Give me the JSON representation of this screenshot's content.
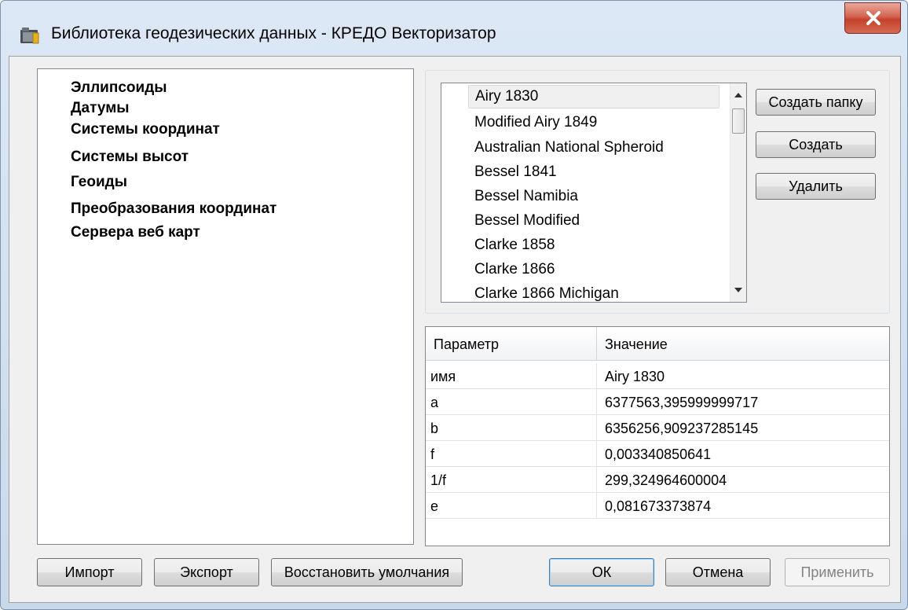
{
  "window": {
    "title": "Библиотека геодезических данных - КРЕДО Векторизатор",
    "close_symbol": "x"
  },
  "tree": {
    "items": [
      {
        "label": "Эллипсоиды"
      },
      {
        "label": "Датумы"
      },
      {
        "label": "Системы координат"
      },
      {
        "label": "Системы высот"
      },
      {
        "label": "Геоиды"
      },
      {
        "label": "Преобразования координат"
      },
      {
        "label": "Сервера веб карт"
      }
    ]
  },
  "list": {
    "selected": "Airy 1830",
    "items": [
      {
        "label": "Airy 1830"
      },
      {
        "label": "Modified Airy 1849"
      },
      {
        "label": "Australian National Spheroid"
      },
      {
        "label": "Bessel 1841"
      },
      {
        "label": "Bessel Namibia"
      },
      {
        "label": "Bessel Modified"
      },
      {
        "label": "Clarke 1858"
      },
      {
        "label": "Clarke 1866"
      },
      {
        "label": "Clarke 1866 Michigan"
      }
    ]
  },
  "side_buttons": {
    "create_folder": "Создать папку",
    "create": "Создать",
    "delete": "Удалить"
  },
  "properties": {
    "columns": {
      "param": "Параметр",
      "value": "Значение"
    },
    "rows": [
      {
        "param": "имя",
        "value": "Airy 1830"
      },
      {
        "param": "a",
        "value": "6377563,395999999717"
      },
      {
        "param": "b",
        "value": "6356256,909237285145"
      },
      {
        "param": "f",
        "value": "0,003340850641"
      },
      {
        "param": "1/f",
        "value": "299,324964600004"
      },
      {
        "param": "e",
        "value": "0,081673373874"
      }
    ]
  },
  "footer": {
    "import": "Импорт",
    "export": "Экспорт",
    "restore_defaults": "Восстановить умолчания",
    "ok": "ОК",
    "cancel": "Отмена",
    "apply": "Применить",
    "apply_enabled": false
  },
  "icons": {
    "app": "library-folder-icon",
    "close": "close-icon",
    "scroll_up": "scroll-up-arrow-icon",
    "scroll_down": "scroll-down-arrow-icon"
  },
  "colors": {
    "close_button": "#c2412c",
    "default_button_border": "#3c7fb1",
    "disabled_text": "#838383"
  }
}
